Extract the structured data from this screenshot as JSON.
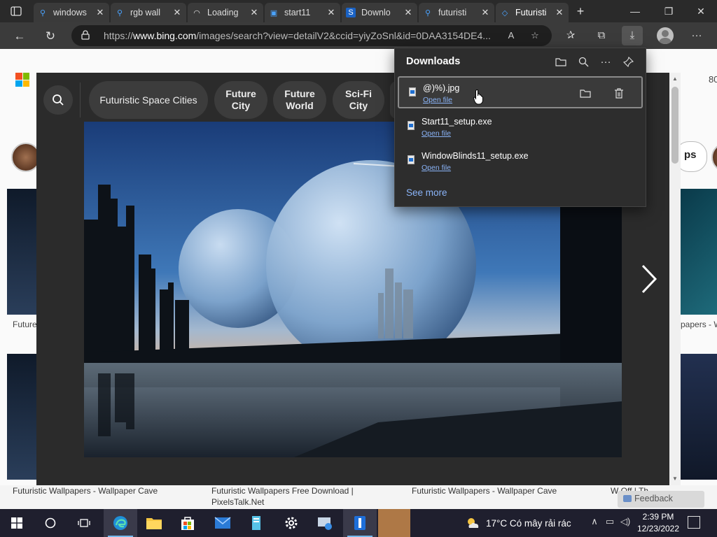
{
  "tabs": [
    {
      "title": "windows",
      "icon": "search-icon"
    },
    {
      "title": "rgb wall",
      "icon": "search-icon"
    },
    {
      "title": "Loading",
      "icon": "loading-icon"
    },
    {
      "title": "start11",
      "icon": "page-icon"
    },
    {
      "title": "Downlo",
      "icon": "stardock-icon"
    },
    {
      "title": "futuristi",
      "icon": "search-icon"
    },
    {
      "title": "Futuristi",
      "icon": "bing-icon"
    }
  ],
  "address": {
    "url_prefix": "https://",
    "url_domain": "www.bing.com",
    "url_rest": "/images/search?view=detailV2&ccid=yiyZoSnl&id=0DAA3154DE4..."
  },
  "background": {
    "right_number": "80",
    "pill_text": "ps",
    "captions_top": [
      "Future",
      "papers - W"
    ]
  },
  "viewer": {
    "chips": [
      {
        "label": "Futuristic Space Cities"
      },
      {
        "label": "Future City"
      },
      {
        "label": "Future World"
      },
      {
        "label": "Sci-Fi City"
      }
    ]
  },
  "captions_bottom": [
    "Futuristic Wallpapers - Wallpaper Cave",
    "Futuristic Wallpapers Free Download | PixelsTalk.Net",
    "Futuristic Wallpapers - Wallpaper Cave",
    "W Off | Th"
  ],
  "feedback": "Feedback",
  "downloads": {
    "title": "Downloads",
    "items": [
      {
        "name": "@)%).jpg",
        "action": "Open file"
      },
      {
        "name": "Start11_setup.exe",
        "action": "Open file"
      },
      {
        "name": "WindowBlinds11_setup.exe",
        "action": "Open file"
      }
    ],
    "see_more": "See more"
  },
  "taskbar": {
    "weather": "17°C  Có mây rải rác",
    "time": "2:39 PM",
    "date": "12/23/2022"
  }
}
